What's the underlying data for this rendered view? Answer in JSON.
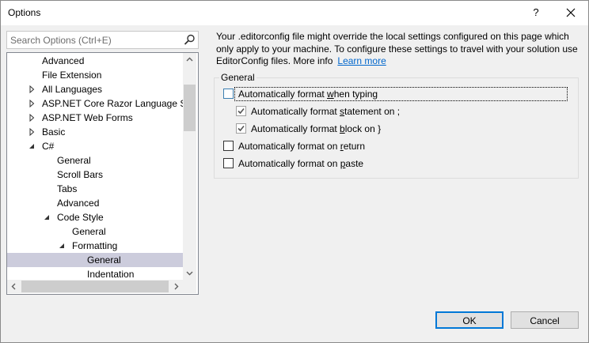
{
  "window": {
    "title": "Options",
    "help_label": "?"
  },
  "search": {
    "placeholder": "Search Options (Ctrl+E)"
  },
  "tree": {
    "items": [
      {
        "label": "Advanced",
        "indent": 0,
        "arrow": "none"
      },
      {
        "label": "File Extension",
        "indent": 0,
        "arrow": "none"
      },
      {
        "label": "All Languages",
        "indent": 0,
        "arrow": "collapsed"
      },
      {
        "label": "ASP.NET Core Razor Language Ser",
        "indent": 0,
        "arrow": "collapsed"
      },
      {
        "label": "ASP.NET Web Forms",
        "indent": 0,
        "arrow": "collapsed"
      },
      {
        "label": "Basic",
        "indent": 0,
        "arrow": "collapsed"
      },
      {
        "label": "C#",
        "indent": 0,
        "arrow": "expanded"
      },
      {
        "label": "General",
        "indent": 1,
        "arrow": "none"
      },
      {
        "label": "Scroll Bars",
        "indent": 1,
        "arrow": "none"
      },
      {
        "label": "Tabs",
        "indent": 1,
        "arrow": "none"
      },
      {
        "label": "Advanced",
        "indent": 1,
        "arrow": "none"
      },
      {
        "label": "Code Style",
        "indent": 1,
        "arrow": "expanded"
      },
      {
        "label": "General",
        "indent": 2,
        "arrow": "none"
      },
      {
        "label": "Formatting",
        "indent": 2,
        "arrow": "expanded"
      },
      {
        "label": "General",
        "indent": 3,
        "arrow": "none",
        "selected": true
      },
      {
        "label": "Indentation",
        "indent": 3,
        "arrow": "none"
      }
    ]
  },
  "info": {
    "text": "Your .editorconfig file might override the local settings configured on this page which only apply to your machine. To configure these settings to travel with your solution use EditorConfig files. More info",
    "link": "Learn more"
  },
  "general_group": {
    "label": "General",
    "options": [
      {
        "pre": "Automatically format ",
        "key": "w",
        "post": "hen typing",
        "checked": false,
        "indent": 0,
        "focused": true
      },
      {
        "pre": "Automatically format ",
        "key": "s",
        "post": "tatement on ;",
        "checked": true,
        "indent": 1
      },
      {
        "pre": "Automatically format ",
        "key": "b",
        "post": "lock on }",
        "checked": true,
        "indent": 1
      },
      {
        "pre": "Automatically format on ",
        "key": "r",
        "post": "eturn",
        "checked": false,
        "indent": 0
      },
      {
        "pre": "Automatically format on ",
        "key": "p",
        "post": "aste",
        "checked": false,
        "indent": 0
      }
    ]
  },
  "buttons": {
    "ok": "OK",
    "cancel": "Cancel"
  }
}
